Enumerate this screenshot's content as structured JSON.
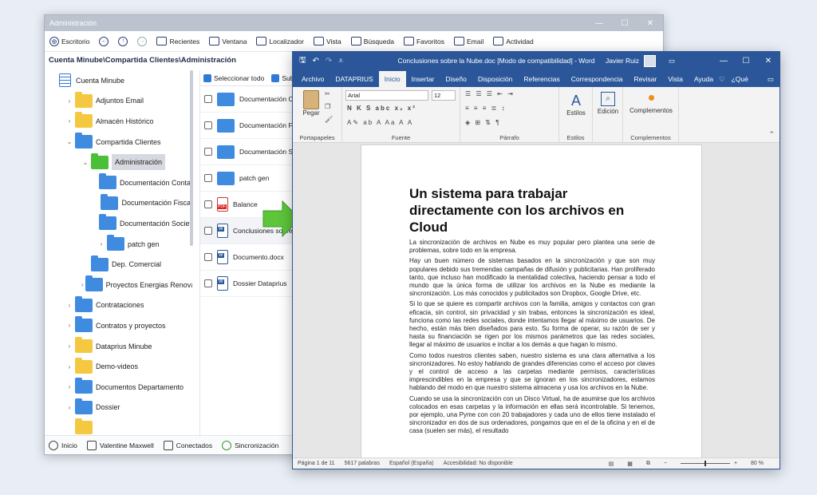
{
  "explorer": {
    "title": "Administración",
    "toolbar": [
      {
        "label": "Escritorio",
        "icon": "desktop-icon"
      },
      {
        "label": "",
        "icon": "back-icon"
      },
      {
        "label": "",
        "icon": "up-icon"
      },
      {
        "label": "",
        "icon": "forward-icon"
      },
      {
        "label": "Recientes",
        "icon": "recent-icon"
      },
      {
        "label": "Ventana",
        "icon": "window-icon"
      },
      {
        "label": "Localizador",
        "icon": "locator-icon"
      },
      {
        "label": "Vista",
        "icon": "view-icon"
      },
      {
        "label": "Búsqueda",
        "icon": "search-icon"
      },
      {
        "label": "Favoritos",
        "icon": "favorites-icon"
      },
      {
        "label": "Email",
        "icon": "email-icon"
      },
      {
        "label": "Actividad",
        "icon": "activity-icon"
      }
    ],
    "path": "Cuenta Minube\\Compartida Clientes\\Administración",
    "tree": [
      {
        "label": "Cuenta Minube",
        "indent": 0,
        "color": "root",
        "chev": ""
      },
      {
        "label": "Adjuntos Email",
        "indent": 1,
        "color": "yel",
        "chev": "›"
      },
      {
        "label": "Almacén Histórico",
        "indent": 1,
        "color": "yel",
        "chev": "›"
      },
      {
        "label": "Compartida Clientes",
        "indent": 1,
        "color": "blu",
        "chev": "⌄"
      },
      {
        "label": "Administración",
        "indent": 2,
        "color": "grn",
        "chev": "⌄",
        "selected": true
      },
      {
        "label": "Documentación Contable",
        "indent": 3,
        "color": "blu",
        "chev": ""
      },
      {
        "label": "Documentación Fiscal",
        "indent": 3,
        "color": "blu",
        "chev": ""
      },
      {
        "label": "Documentación Societaria",
        "indent": 3,
        "color": "blu",
        "chev": ""
      },
      {
        "label": "patch gen",
        "indent": 3,
        "color": "blu",
        "chev": "›"
      },
      {
        "label": "Dep. Comercial",
        "indent": 2,
        "color": "blu",
        "chev": ""
      },
      {
        "label": "Proyectos Energias Renovables",
        "indent": 2,
        "color": "blu",
        "chev": "›"
      },
      {
        "label": "Contrataciones",
        "indent": 1,
        "color": "blu",
        "chev": "›"
      },
      {
        "label": "Contratos y proyectos",
        "indent": 1,
        "color": "blu",
        "chev": "›"
      },
      {
        "label": "Dataprius Minube",
        "indent": 1,
        "color": "yel",
        "chev": "›"
      },
      {
        "label": "Demo-videos",
        "indent": 1,
        "color": "yel",
        "chev": "›"
      },
      {
        "label": "Documentos Departamento",
        "indent": 1,
        "color": "blu",
        "chev": "›"
      },
      {
        "label": "Dossier",
        "indent": 1,
        "color": "blu",
        "chev": "›"
      },
      {
        "label": "",
        "indent": 1,
        "color": "yel",
        "chev": ""
      }
    ],
    "files_header": {
      "select_all": "Seleccionar todo",
      "sub": "Sub"
    },
    "files": [
      {
        "name": "Documentación Contable",
        "type": "folder"
      },
      {
        "name": "Documentación Fiscal",
        "type": "folder"
      },
      {
        "name": "Documentación Societaria",
        "type": "folder"
      },
      {
        "name": "patch gen",
        "type": "folder"
      },
      {
        "name": "Balance",
        "type": "pdf"
      },
      {
        "name": "Conclusiones sobre la Nube.doc",
        "type": "doc"
      },
      {
        "name": "Documento.docx",
        "type": "doc"
      },
      {
        "name": "Dossier Dataprius",
        "type": "doc"
      }
    ],
    "status": [
      {
        "label": "Inicio",
        "icon": "home-icon"
      },
      {
        "label": "Valentine Maxwell",
        "icon": "user-icon"
      },
      {
        "label": "Conectados",
        "icon": "connected-icon"
      },
      {
        "label": "Sincronización",
        "icon": "sync-icon"
      }
    ]
  },
  "word": {
    "title": "Conclusiones sobre la Nube.doc [Modo de compatibilidad] - Word",
    "user": "Javier Ruiz",
    "tabs": [
      "Archivo",
      "DATAPRIUS",
      "Inicio",
      "Insertar",
      "Diseño",
      "Disposición",
      "Referencias",
      "Correspondencia",
      "Revisar",
      "Vista",
      "Ayuda"
    ],
    "active_tab": "Inicio",
    "tell_me": "¿Qué des",
    "ribbon": {
      "paste": "Pegar",
      "font": "Arial",
      "size": "12",
      "estilos": "Estilos",
      "edicion": "Edición",
      "complementos": "Complementos",
      "groups": [
        "Portapapeles",
        "Fuente",
        "Párrafo",
        "Estilos",
        "Complementos"
      ]
    },
    "document": {
      "heading": "Un sistema para trabajar directamente con los archivos en Cloud",
      "paragraphs": [
        "La sincronización de archivos en Nube es muy popular pero plantea una serie de problemas, sobre todo en la empresa.",
        "Hay un buen número de sistemas basados en la sincronización y que son muy populares debido sus tremendas campañas de difusión y publicitarias. Han proliferado tanto, que incluso han modificado la mentalidad colectiva, haciendo pensar a todo el mundo que la única forma de utilizar los archivos en la Nube es mediante la sincronización. Los más conocidos y publicitados son Dropbox, Google Drive, etc.",
        "Si lo que se quiere es compartir archivos con la familia, amigos y contactos con gran eficacia, sin control, sin privacidad y sin trabas, entonces la sincronización es ideal, funciona como las redes sociales, donde intentamos llegar al máximo de usuarios. De hecho, están más bien diseñados para esto. Su forma de operar, su razón de ser y hasta su financiación se rigen por los mismos parámetros que las redes sociales, llegar al máximo de usuarios e incitar a los demás a que hagan lo mismo.",
        "Como todos nuestros clientes saben, nuestro sistema es una clara alternativa a los sincronizadores. No estoy hablando de grandes diferencias como el acceso por claves y el control de acceso a las carpetas mediante permisos, características imprescindibles en la empresa y que se ignoran en los sincronizadores, estamos hablando del modo en que nuestro sistema almacena y usa los archivos en la Nube.",
        "Cuando se usa la sincronización con un Disco Virtual, ha de asumirse que los archivos colocados en esas carpetas y la información en ellas será incontrolable. Si tenemos, por ejemplo, una Pyme con con 20 trabajadores y cada uno de ellos tiene instalado el sincronizador en dos de sus ordenadores, pongamos que en el de la oficina y en el de casa (suelen ser más), el resultado"
      ]
    },
    "status": {
      "page": "Página 1 de 11",
      "words": "5617 palabras",
      "lang": "Español (España)",
      "access": "Accesibilidad: No disponible",
      "zoom": "80 %"
    }
  },
  "colors": {
    "word_blue": "#2b579a",
    "folder_blue": "#3f8be0",
    "folder_yellow": "#f5c842",
    "arrow_green": "#5cc53a"
  }
}
